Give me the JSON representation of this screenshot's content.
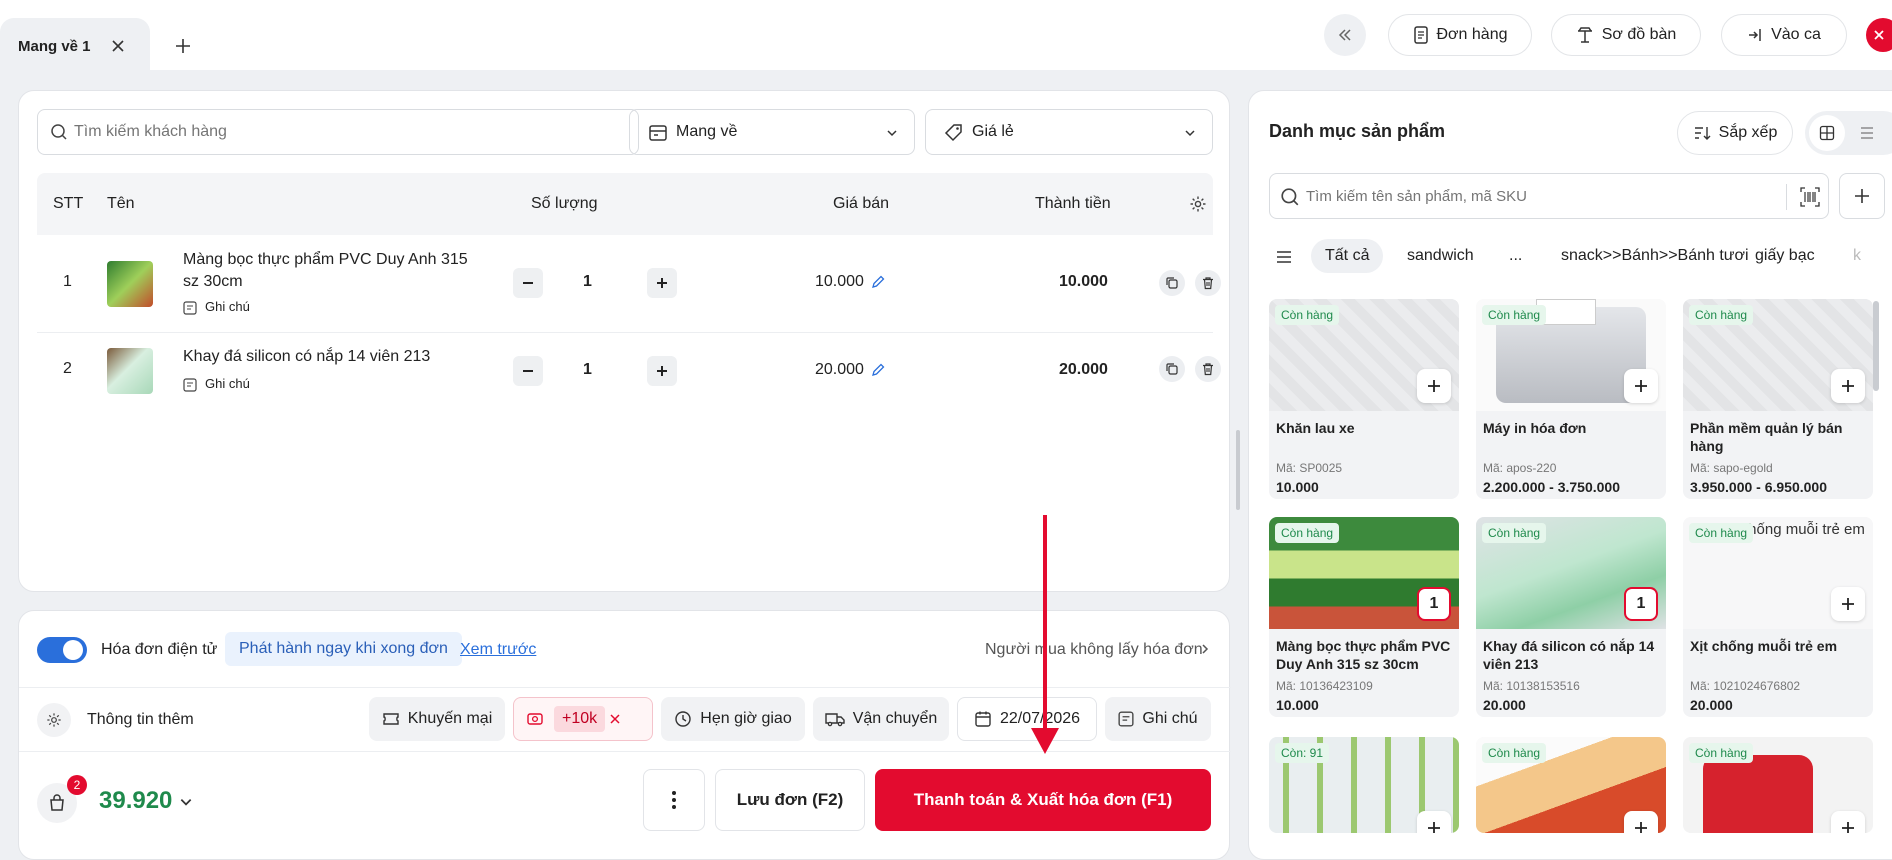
{
  "tabs": [
    {
      "label": "Mang về 1"
    }
  ],
  "header": {
    "orders": "Đơn hàng",
    "table_map": "Sơ đồ bàn",
    "shift": "Vào ca"
  },
  "order": {
    "search_placeholder": "Tìm kiếm khách hàng",
    "delivery_type": "Mang về",
    "price_list": "Giá lẻ",
    "columns": {
      "stt": "STT",
      "name": "Tên",
      "qty": "Số lượng",
      "price": "Giá bán",
      "total": "Thành tiền"
    },
    "items": [
      {
        "stt": "1",
        "name": "Màng bọc thực phẩm PVC Duy Anh 315 sz 30cm",
        "note": "Ghi chú",
        "qty": "1",
        "price": "10.000",
        "total": "10.000"
      },
      {
        "stt": "2",
        "name": "Khay đá silicon có nắp 14 viên 213",
        "note": "Ghi chú",
        "qty": "1",
        "price": "20.000",
        "total": "20.000"
      }
    ]
  },
  "invoice": {
    "label": "Hóa đơn điện tử",
    "mode": "Phát hành ngay khi xong đơn",
    "preview": "Xem trước",
    "buyer": "Người mua không lấy hóa đơn",
    "enabled": true
  },
  "extra": {
    "more_info": "Thông tin thêm",
    "promo": "Khuyến mại",
    "surcharge": "+10k",
    "schedule": "Hẹn giờ giao",
    "shipping": "Vận chuyển",
    "date": "22/07/2026",
    "note": "Ghi chú"
  },
  "footer": {
    "cart_count": "2",
    "total": "39.920",
    "save": "Lưu đơn (F2)",
    "pay": "Thanh toán & Xuất hóa đơn (F1)"
  },
  "catalog": {
    "title": "Danh mục sản phẩm",
    "sort": "Sắp xếp",
    "search_placeholder": "Tìm kiếm tên sản phẩm, mã SKU",
    "categories": [
      "Tất cả",
      "sandwich",
      "...",
      "snack>>Bánh>>Bánh tươi",
      "giấy bạc",
      "k"
    ],
    "products": [
      {
        "badge": "Còn hàng",
        "name": "Khăn lau xe",
        "sku": "Mã: SP0025",
        "price": "10.000"
      },
      {
        "badge": "Còn hàng",
        "name": "Máy in hóa đơn",
        "sku": "Mã: apos-220",
        "price": "2.200.000 - 3.750.000"
      },
      {
        "badge": "Còn hàng",
        "name": "Phần mềm quản lý bán hàng",
        "sku": "Mã: sapo-egold",
        "price": "3.950.000 - 6.950.000"
      },
      {
        "badge": "Còn hàng",
        "name": "Màng bọc thực phẩm PVC Duy Anh 315 sz 30cm",
        "sku": "Mã: 10136423109",
        "price": "10.000",
        "qty": "1"
      },
      {
        "badge": "Còn hàng",
        "name": "Khay đá silicon có nắp 14 viên 213",
        "sku": "Mã: 10138153516",
        "price": "20.000",
        "qty": "1"
      },
      {
        "badge": "Còn hàng",
        "name": "Xịt chống muỗi trẻ em",
        "alt": "Xịt chống muỗi trẻ em",
        "sku": "Mã: 1021024676802",
        "price": "20.000"
      },
      {
        "badge": "Còn: 91"
      },
      {
        "badge": "Còn hàng"
      },
      {
        "badge": "Còn hàng"
      }
    ]
  },
  "colors": {
    "accent": "#e30b2f",
    "green": "#1f8a4c",
    "toggle": "#2a6fdb"
  }
}
